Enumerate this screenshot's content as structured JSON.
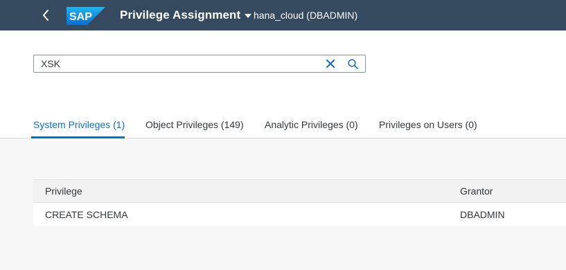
{
  "shell": {
    "logo_text": "SAP",
    "app_title": "Privilege Assignment",
    "context": "hana_cloud (DBADMIN)"
  },
  "search": {
    "value": "XSK"
  },
  "tabs": [
    {
      "label": "System Privileges (1)",
      "active": true
    },
    {
      "label": "Object Privileges (149)",
      "active": false
    },
    {
      "label": "Analytic Privileges (0)",
      "active": false
    },
    {
      "label": "Privileges on Users (0)",
      "active": false
    }
  ],
  "table": {
    "columns": [
      "Privilege",
      "Grantor"
    ],
    "rows": [
      [
        "CREATE SCHEMA",
        "DBADMIN"
      ]
    ]
  },
  "colors": {
    "shell_bg": "#354a5f",
    "accent": "#0a6ed1",
    "logo_blue": "#0a6ed1"
  }
}
